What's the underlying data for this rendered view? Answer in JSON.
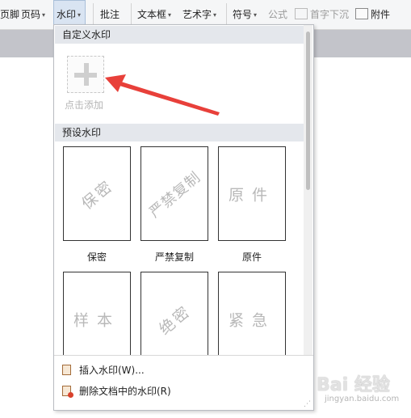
{
  "toolbar": {
    "items": {
      "footer": "页脚",
      "page_number": "页码",
      "watermark": "水印",
      "comment": "批注",
      "text_box": "文本框",
      "word_art": "艺术字",
      "symbol": "符号",
      "formula": "公式",
      "drop_cap": "首字下沉",
      "attachment": "附件"
    },
    "caret": "▾"
  },
  "panel": {
    "custom_section_title": "自定义水印",
    "add_label": "点击添加",
    "preset_section_title": "预设水印",
    "presets": [
      {
        "text": "保密",
        "label": "保密",
        "style": "rotated"
      },
      {
        "text": "严禁复制",
        "label": "严禁复制",
        "style": "rotated"
      },
      {
        "text": "原件",
        "label": "原件",
        "style": "flat"
      },
      {
        "text": "样本",
        "label": "",
        "style": "flat"
      },
      {
        "text": "绝密",
        "label": "",
        "style": "rotated"
      },
      {
        "text": "紧急",
        "label": "",
        "style": "flat"
      }
    ],
    "menu": {
      "insert": "插入水印(W)...",
      "delete": "删除文档中的水印(R)"
    }
  },
  "site_watermark": {
    "logo": "Bai 经验",
    "url": "jingyan.baidu.com"
  },
  "colors": {
    "arrow": "#e8403a",
    "panel_border": "#b9bcc2",
    "section_header": "#e4e7ec",
    "page_background": "#c3c4ca"
  }
}
